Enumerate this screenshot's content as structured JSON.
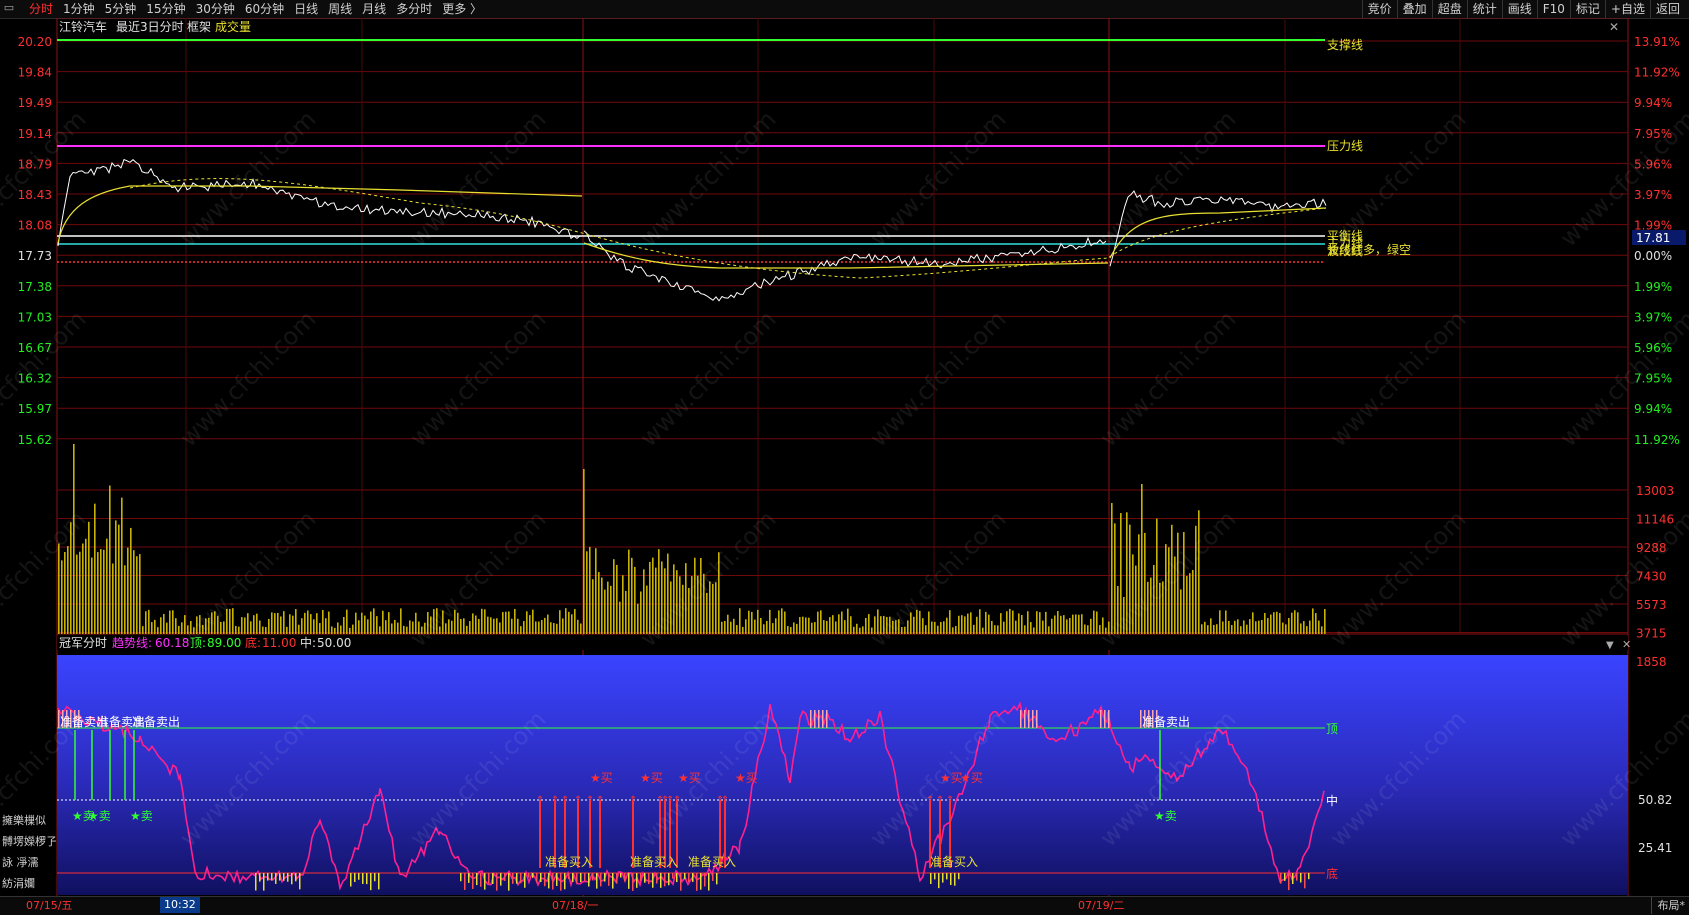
{
  "toolbar": {
    "tabs": [
      "分时",
      "1分钟",
      "5分钟",
      "15分钟",
      "30分钟",
      "60分钟",
      "日线",
      "周线",
      "月线",
      "多分时",
      "更多 〉"
    ],
    "active_tab": 0,
    "right": [
      "竞价",
      "叠加",
      "超盘",
      "统计",
      "画线",
      "F10",
      "标记",
      "+自选",
      "返回"
    ]
  },
  "header": {
    "stock": "江铃汽车",
    "mode": "最近3日分时",
    "frame": "框架",
    "volume_label": "成交量"
  },
  "price_axis": {
    "left": [
      "20.20",
      "19.84",
      "19.49",
      "19.14",
      "18.79",
      "18.43",
      "18.08",
      "17.73",
      "17.38",
      "17.03",
      "16.67",
      "16.32",
      "15.97",
      "15.62"
    ],
    "right": [
      "13.91%",
      "11.92%",
      "9.94%",
      "7.95%",
      "5.96%",
      "3.97%",
      "1.99%",
      "0.00%",
      "1.99%",
      "3.97%",
      "5.96%",
      "7.95%",
      "9.94%",
      "11.92%"
    ],
    "current": "17.81"
  },
  "annotations": {
    "support": "支撑线",
    "pressure": "压力线",
    "balance": "平衡线",
    "main": "主力线",
    "long": "长线红多，绿空",
    "mid": "波段线"
  },
  "volume_axis": [
    "13003",
    "11146",
    "9288",
    "7430",
    "5573",
    "3715",
    "1858"
  ],
  "indicator": {
    "name": "冠军分时",
    "trend_label": "趋势线:",
    "trend": "60.18",
    "top_label": "顶:",
    "top": "89.00",
    "bottom_label": "底:",
    "bottom": "11.00",
    "mid_label": "中:",
    "mid": "50.00",
    "axis": [
      "50.82",
      "25.41"
    ],
    "zone_top": "顶",
    "zone_mid": "中",
    "zone_bottom": "底",
    "sell_ready": "准备卖出",
    "buy_ready": "准备买入",
    "buy": "★买",
    "sell": "★卖"
  },
  "left_menu": [
    "擁樂樔似",
    "髆塄嬫椤孒",
    "詠  凈濡",
    "紡涓孄"
  ],
  "dates": [
    "07/15/五",
    "07/18/一",
    "07/19/二"
  ],
  "time_cursor": "10:32",
  "layout_label": "布局*",
  "colors": {
    "up": "#ff3030",
    "down": "#22ee22",
    "price": "#ffffff",
    "avg": "#e8e030",
    "pressure": "#ff30ff",
    "support": "#30ff30",
    "balance": "#ffffff",
    "base": "#30e0e0"
  }
}
